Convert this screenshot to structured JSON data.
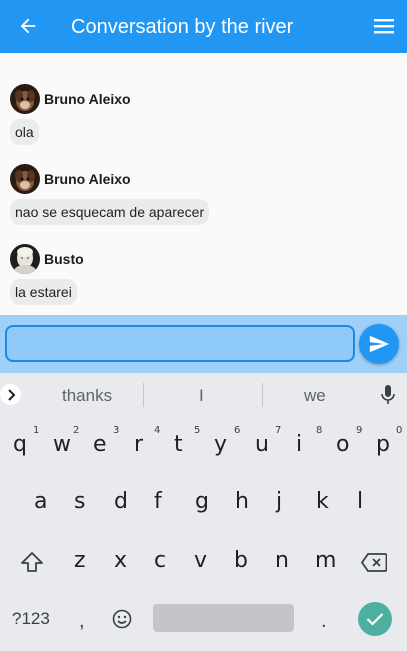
{
  "appbar": {
    "title": "Conversation by the river",
    "back_icon": "arrow-left-icon",
    "menu_icon": "hamburger-menu-icon",
    "color": "#2196f3"
  },
  "messages": [
    {
      "author": "Bruno Aleixo",
      "text": "ola"
    },
    {
      "author": "Bruno Aleixo",
      "text": "nao se esquecam de aparecer"
    },
    {
      "author": "Busto",
      "text": "la estarei"
    }
  ],
  "input": {
    "value": "",
    "placeholder": ""
  },
  "keyboard": {
    "suggestions": [
      "thanks",
      "I",
      "we"
    ],
    "row1": [
      {
        "ch": "q",
        "num": "1"
      },
      {
        "ch": "w",
        "num": "2"
      },
      {
        "ch": "e",
        "num": "3"
      },
      {
        "ch": "r",
        "num": "4"
      },
      {
        "ch": "t",
        "num": "5"
      },
      {
        "ch": "y",
        "num": "6"
      },
      {
        "ch": "u",
        "num": "7"
      },
      {
        "ch": "i",
        "num": "8"
      },
      {
        "ch": "o",
        "num": "9"
      },
      {
        "ch": "p",
        "num": "0"
      }
    ],
    "row2": [
      "a",
      "s",
      "d",
      "f",
      "g",
      "h",
      "j",
      "k",
      "l"
    ],
    "row3": [
      "z",
      "x",
      "c",
      "v",
      "b",
      "n",
      "m"
    ],
    "symbols_label": "?123",
    "comma": ",",
    "period": "."
  }
}
